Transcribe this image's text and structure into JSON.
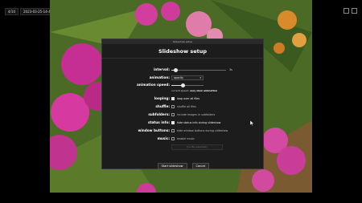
{
  "topbar": {
    "index": "4/10",
    "filename": "2023-03-25-14-46-25-000.jpg",
    "zoom": "25%",
    "extra": "57"
  },
  "dialog": {
    "window_title": "Slideshow setup",
    "title": "Slideshow setup",
    "interval": {
      "label": "interval:",
      "value": 0.05,
      "unit": "3s"
    },
    "animation": {
      "label": "animation:",
      "value": "opacity"
    },
    "animation_speed": {
      "label": "animation speed:",
      "value": 0.35
    },
    "current_speed": {
      "prefix": "current speed:",
      "value": "very slow animation"
    },
    "looping": {
      "label": "looping:",
      "text": "loop over all files",
      "checked": true
    },
    "shuffle": {
      "label": "shuffle:",
      "text": "shuffle all files",
      "checked": false
    },
    "subfolders": {
      "label": "subfolders:",
      "text": "include images in subfolders",
      "checked": false
    },
    "status_info": {
      "label": "status info:",
      "text": "hide status info during slideshow",
      "checked": true
    },
    "window_buttons": {
      "label": "window buttons:",
      "text": "hide window buttons during slideshow",
      "checked": false
    },
    "music": {
      "label": "music:",
      "text": "enable music",
      "checked": false,
      "file": "[no file selected]"
    },
    "buttons": {
      "start": "Start slideshow",
      "cancel": "Cancel"
    }
  },
  "colors": {
    "accent": "#e6e6e6",
    "dialog_bg": "#1c1c1c",
    "flower": "#d63aa0"
  }
}
